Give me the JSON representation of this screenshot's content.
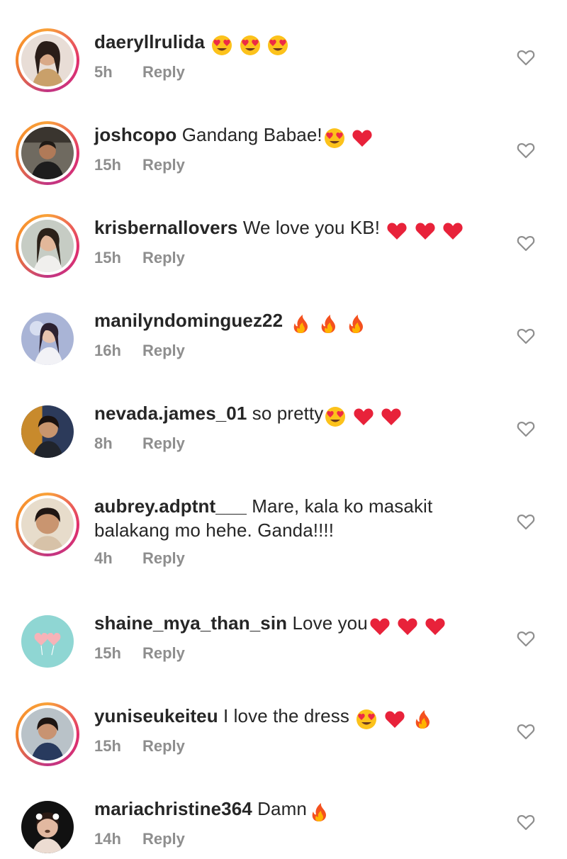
{
  "reply_label": "Reply",
  "colors": {
    "username": "#262626",
    "meta": "#8e8e8e",
    "story_ring_start": "#f9a23a",
    "story_ring_end": "#c13584"
  },
  "comments": [
    {
      "username": "daeryllrulida",
      "text": "",
      "emojis": [
        "heart-eyes",
        "heart-eyes",
        "heart-eyes"
      ],
      "time": "5h",
      "ring": true
    },
    {
      "username": "joshcopo",
      "text": "Gandang Babae!",
      "emojis": [
        "heart-eyes",
        "red-heart"
      ],
      "time": "15h",
      "ring": true
    },
    {
      "username": "krisbernallovers",
      "text": "We love you KB!",
      "emojis": [
        "red-heart",
        "red-heart",
        "red-heart"
      ],
      "time": "15h",
      "ring": true
    },
    {
      "username": "manilyndominguez22",
      "text": "",
      "emojis": [
        "fire",
        "fire",
        "fire"
      ],
      "time": "16h",
      "ring": false
    },
    {
      "username": "nevada.james_01",
      "text": "so pretty",
      "emojis": [
        "heart-eyes",
        "red-heart",
        "red-heart"
      ],
      "time": "8h",
      "ring": false
    },
    {
      "username": "aubrey.adptnt___",
      "text": "Mare, kala ko masakit",
      "text2": "balakang mo hehe. Ganda!!!!",
      "emojis": [],
      "time": "4h",
      "ring": true
    },
    {
      "username": "shaine_mya_than_sin",
      "text": "Love you",
      "emojis": [
        "red-heart",
        "red-heart",
        "red-heart"
      ],
      "time": "15h",
      "ring": false
    },
    {
      "username": "yuniseukeiteu",
      "text": "I love the dress",
      "emojis": [
        "heart-eyes",
        "red-heart",
        "fire"
      ],
      "time": "15h",
      "ring": true
    },
    {
      "username": "mariachristine364",
      "text": "Damn",
      "emojis": [
        "fire"
      ],
      "time": "14h",
      "ring": false
    }
  ]
}
